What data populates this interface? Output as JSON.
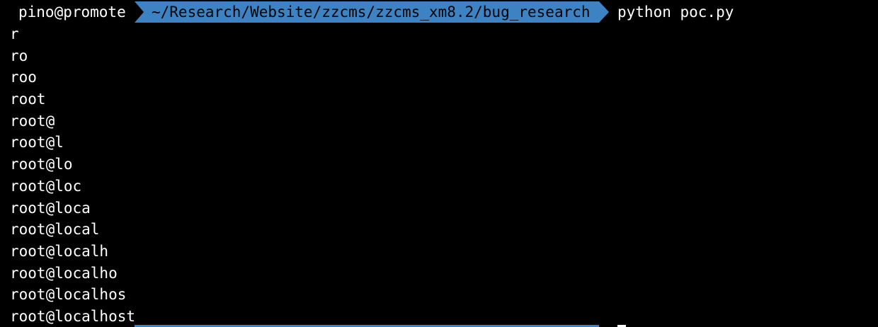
{
  "prompt": {
    "user_host": "pino@promote",
    "path": "~/Research/Website/zzcms/zzcms_xm8.2/bug_research",
    "command": "python poc.py"
  },
  "output_lines": [
    "r",
    "ro",
    "roo",
    "root",
    "root@",
    "root@l",
    "root@lo",
    "root@loc",
    "root@loca",
    "root@local",
    "root@localh",
    "root@localho",
    "root@localhos",
    "root@localhost"
  ],
  "colors": {
    "background": "#000000",
    "text": "#ffffff",
    "path_segment": "#3d83c3",
    "path_text": "#000000"
  }
}
